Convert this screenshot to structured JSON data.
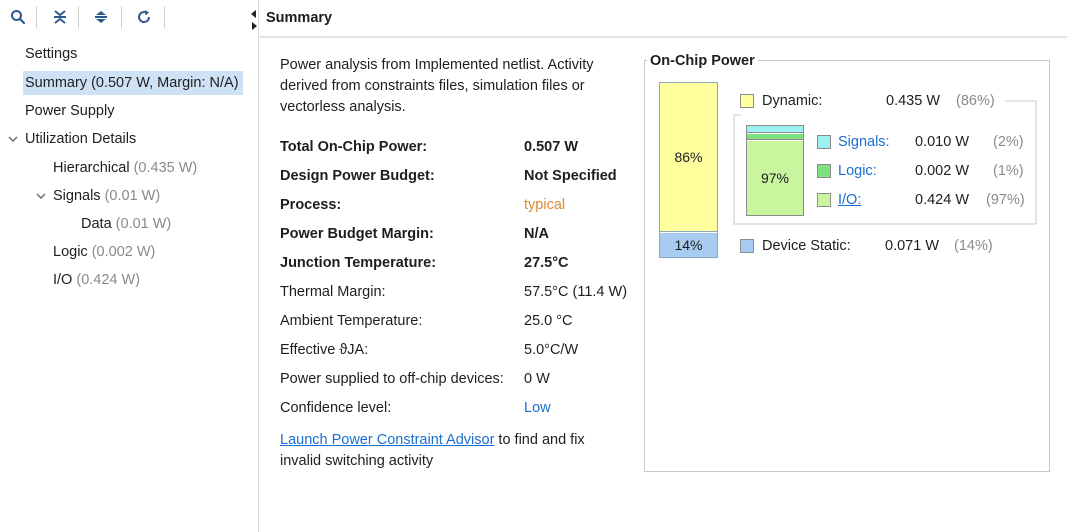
{
  "toolbar": {
    "search_icon": "search-icon",
    "collapse_all_icon": "collapse-all-icon",
    "expand_all_icon": "expand-all-icon",
    "refresh_icon": "refresh-icon"
  },
  "tree": {
    "settings": "Settings",
    "summary": "Summary (0.507 W, Margin: N/A)",
    "power_supply": "Power Supply",
    "utilization_details": "Utilization Details",
    "hierarchical": {
      "label": "Hierarchical",
      "value": "(0.435 W)"
    },
    "signals": {
      "label": "Signals",
      "value": "(0.01 W)"
    },
    "data": {
      "label": "Data",
      "value": "(0.01 W)"
    },
    "logic": {
      "label": "Logic",
      "value": "(0.002 W)"
    },
    "io": {
      "label": "I/O",
      "value": "(0.424 W)"
    }
  },
  "header": {
    "title": "Summary"
  },
  "intro": "Power analysis from Implemented netlist. Activity derived from constraints files, simulation files or vectorless analysis.",
  "props": [
    {
      "label": "Total On-Chip Power:",
      "value": "0.507 W"
    },
    {
      "label": "Design Power Budget:",
      "value": "Not Specified"
    },
    {
      "label": "Process:",
      "value": "typical"
    },
    {
      "label": "Power Budget Margin:",
      "value": "N/A"
    },
    {
      "label": "Junction Temperature:",
      "value": "27.5°C"
    },
    {
      "label": "Thermal Margin:",
      "value": "57.5°C (11.4 W)"
    },
    {
      "label": "Ambient Temperature:",
      "value": "25.0 °C"
    },
    {
      "label": "Effective ϑJA:",
      "value": "5.0°C/W"
    },
    {
      "label": "Power supplied to off-chip devices:",
      "value": "0 W"
    },
    {
      "label": "Confidence level:",
      "value": "Low"
    }
  ],
  "advisor": {
    "link": "Launch Power Constraint Advisor",
    "rest": " to find and fix invalid switching activity"
  },
  "onchip": {
    "title": "On-Chip Power",
    "dynamic_fraction": 0.86,
    "dynamic_bar_label": "86%",
    "static_bar_label": "14%",
    "dynamic": {
      "label": "Dynamic:",
      "value": "0.435 W",
      "pct": "(86%)"
    },
    "signals": {
      "label": "Signals:",
      "value": "0.010 W",
      "pct": "(2%)"
    },
    "logic": {
      "label": "Logic:",
      "value": "0.002 W",
      "pct": "(1%)"
    },
    "io": {
      "label": "I/O:",
      "value": "0.424 W",
      "pct": "(97%)"
    },
    "static": {
      "label": "Device Static:",
      "value": "0.071 W",
      "pct": "(14%)"
    },
    "inner_bar_label": "97%",
    "inner_fractions": {
      "signals": 0.02,
      "logic": 0.01,
      "io": 0.97
    }
  },
  "colors": {
    "dynamic": "#ffff9e",
    "static": "#a8cbf2",
    "signals": "#9ef0f0",
    "logic": "#7ee07e",
    "io": "#c9f59e",
    "selection": "#cfe1f5",
    "link": "#1a6fd0",
    "process_value": "#e08a2e"
  }
}
